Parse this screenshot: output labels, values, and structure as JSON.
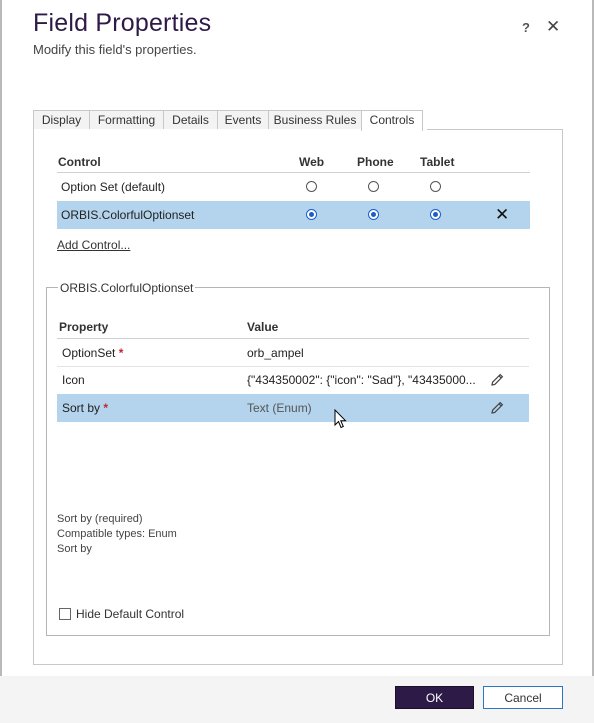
{
  "dialog": {
    "title": "Field Properties",
    "subtitle": "Modify this field's properties.",
    "help_label": "?",
    "close_label": "✕"
  },
  "tabs": [
    {
      "label": "Display"
    },
    {
      "label": "Formatting"
    },
    {
      "label": "Details"
    },
    {
      "label": "Events"
    },
    {
      "label": "Business Rules"
    },
    {
      "label": "Controls",
      "active": true
    }
  ],
  "controls_table": {
    "headers": {
      "control": "Control",
      "web": "Web",
      "phone": "Phone",
      "tablet": "Tablet"
    },
    "rows": [
      {
        "name": "Option Set (default)",
        "web": false,
        "phone": false,
        "tablet": false,
        "selected": false
      },
      {
        "name": "ORBIS.ColorfulOptionset",
        "web": true,
        "phone": true,
        "tablet": true,
        "selected": true,
        "remove_label": "✕"
      }
    ],
    "add_control_label": "Add Control..."
  },
  "control_properties": {
    "legend": "ORBIS.ColorfulOptionset",
    "headers": {
      "property": "Property",
      "value": "Value"
    },
    "rows": [
      {
        "property": "OptionSet",
        "required": true,
        "value": "orb_ampel",
        "editable": false
      },
      {
        "property": "Icon",
        "required": false,
        "value": "{\"434350002\": {\"icon\": \"Sad\"}, \"43435000...",
        "editable": true
      },
      {
        "property": "Sort by",
        "required": true,
        "value": "Text (Enum)",
        "editable": true,
        "selected": true
      }
    ],
    "required_marker": "*",
    "description": {
      "line1": "Sort by (required)",
      "line2": "Compatible types: Enum",
      "line3": "Sort by"
    },
    "hide_default_control": {
      "label": "Hide Default Control",
      "checked": false
    }
  },
  "footer": {
    "ok_label": "OK",
    "cancel_label": "Cancel"
  },
  "colors": {
    "title": "#2e1a47",
    "primary_button": "#2e1a47",
    "selection": "#b3d4ec",
    "required": "#c4262e",
    "radio_selected": "#1b5ecb"
  }
}
